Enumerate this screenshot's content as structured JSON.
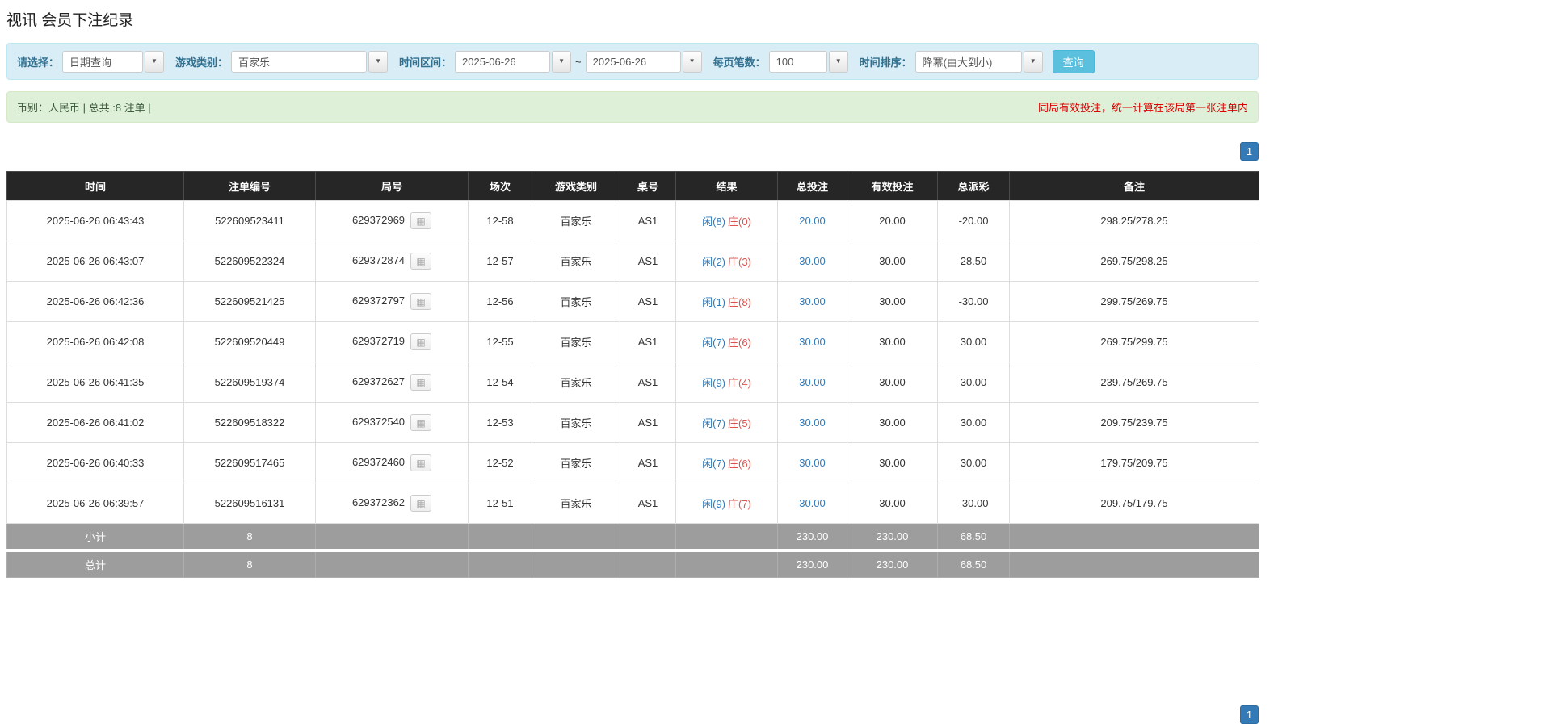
{
  "page": {
    "title": "视讯 会员下注纪录"
  },
  "filters": {
    "select_label": "请选择：",
    "select_value": "日期查询",
    "game_type_label": "游戏类别：",
    "game_type_value": "百家乐",
    "date_range_label": "时间区间：",
    "date_from": "2025-06-26",
    "date_separator": "~",
    "date_to": "2025-06-26",
    "page_size_label": "每页笔数：",
    "page_size_value": "100",
    "sort_label": "时间排序：",
    "sort_value": "降冪(由大到小)",
    "search_button": "查询"
  },
  "summary": {
    "left_text": "币别：人民币 | 总共 :8 注单 |",
    "right_notice": "同局有效投注，统一计算在该局第一张注单内"
  },
  "pagination": {
    "page": "1"
  },
  "colors": {
    "accent_blue": "#337ab7",
    "negative_red": "#e00000",
    "player_blue": "#337ab7",
    "banker_red": "#d9534f",
    "search_button_teal": "#5bc0de",
    "filter_bar_bg": "#d9edf7",
    "summary_bar_bg": "#dff0d8",
    "header_bg": "#262626",
    "footer_bg": "#9d9d9d"
  },
  "table": {
    "headers": [
      "时间",
      "注单编号",
      "局号",
      "场次",
      "游戏类别",
      "桌号",
      "结果",
      "总投注",
      "有效投注",
      "总派彩",
      "备注"
    ],
    "rows": [
      {
        "time": "2025-06-26 06:43:43",
        "bet_id": "522609523411",
        "round_id": "629372969",
        "session": "12-58",
        "game": "百家乐",
        "table_no": "AS1",
        "result_player": "闲(8)",
        "result_banker": "庄(0)",
        "total_bet": "20.00",
        "valid_bet": "20.00",
        "total_payout": "-20.00",
        "remark": "298.25/278.25"
      },
      {
        "time": "2025-06-26 06:43:07",
        "bet_id": "522609522324",
        "round_id": "629372874",
        "session": "12-57",
        "game": "百家乐",
        "table_no": "AS1",
        "result_player": "闲(2)",
        "result_banker": "庄(3)",
        "total_bet": "30.00",
        "valid_bet": "30.00",
        "total_payout": "28.50",
        "remark": "269.75/298.25"
      },
      {
        "time": "2025-06-26 06:42:36",
        "bet_id": "522609521425",
        "round_id": "629372797",
        "session": "12-56",
        "game": "百家乐",
        "table_no": "AS1",
        "result_player": "闲(1)",
        "result_banker": "庄(8)",
        "total_bet": "30.00",
        "valid_bet": "30.00",
        "total_payout": "-30.00",
        "remark": "299.75/269.75"
      },
      {
        "time": "2025-06-26 06:42:08",
        "bet_id": "522609520449",
        "round_id": "629372719",
        "session": "12-55",
        "game": "百家乐",
        "table_no": "AS1",
        "result_player": "闲(7)",
        "result_banker": "庄(6)",
        "total_bet": "30.00",
        "valid_bet": "30.00",
        "total_payout": "30.00",
        "remark": "269.75/299.75"
      },
      {
        "time": "2025-06-26 06:41:35",
        "bet_id": "522609519374",
        "round_id": "629372627",
        "session": "12-54",
        "game": "百家乐",
        "table_no": "AS1",
        "result_player": "闲(9)",
        "result_banker": "庄(4)",
        "total_bet": "30.00",
        "valid_bet": "30.00",
        "total_payout": "30.00",
        "remark": "239.75/269.75"
      },
      {
        "time": "2025-06-26 06:41:02",
        "bet_id": "522609518322",
        "round_id": "629372540",
        "session": "12-53",
        "game": "百家乐",
        "table_no": "AS1",
        "result_player": "闲(7)",
        "result_banker": "庄(5)",
        "total_bet": "30.00",
        "valid_bet": "30.00",
        "total_payout": "30.00",
        "remark": "209.75/239.75"
      },
      {
        "time": "2025-06-26 06:40:33",
        "bet_id": "522609517465",
        "round_id": "629372460",
        "session": "12-52",
        "game": "百家乐",
        "table_no": "AS1",
        "result_player": "闲(7)",
        "result_banker": "庄(6)",
        "total_bet": "30.00",
        "valid_bet": "30.00",
        "total_payout": "30.00",
        "remark": "179.75/209.75"
      },
      {
        "time": "2025-06-26 06:39:57",
        "bet_id": "522609516131",
        "round_id": "629372362",
        "session": "12-51",
        "game": "百家乐",
        "table_no": "AS1",
        "result_player": "闲(9)",
        "result_banker": "庄(7)",
        "total_bet": "30.00",
        "valid_bet": "30.00",
        "total_payout": "-30.00",
        "remark": "209.75/179.75"
      }
    ],
    "subtotal": {
      "label": "小计",
      "count": "8",
      "total_bet": "230.00",
      "valid_bet": "230.00",
      "total_payout": "68.50"
    },
    "total": {
      "label": "总计",
      "count": "8",
      "total_bet": "230.00",
      "valid_bet": "230.00",
      "total_payout": "68.50"
    }
  }
}
